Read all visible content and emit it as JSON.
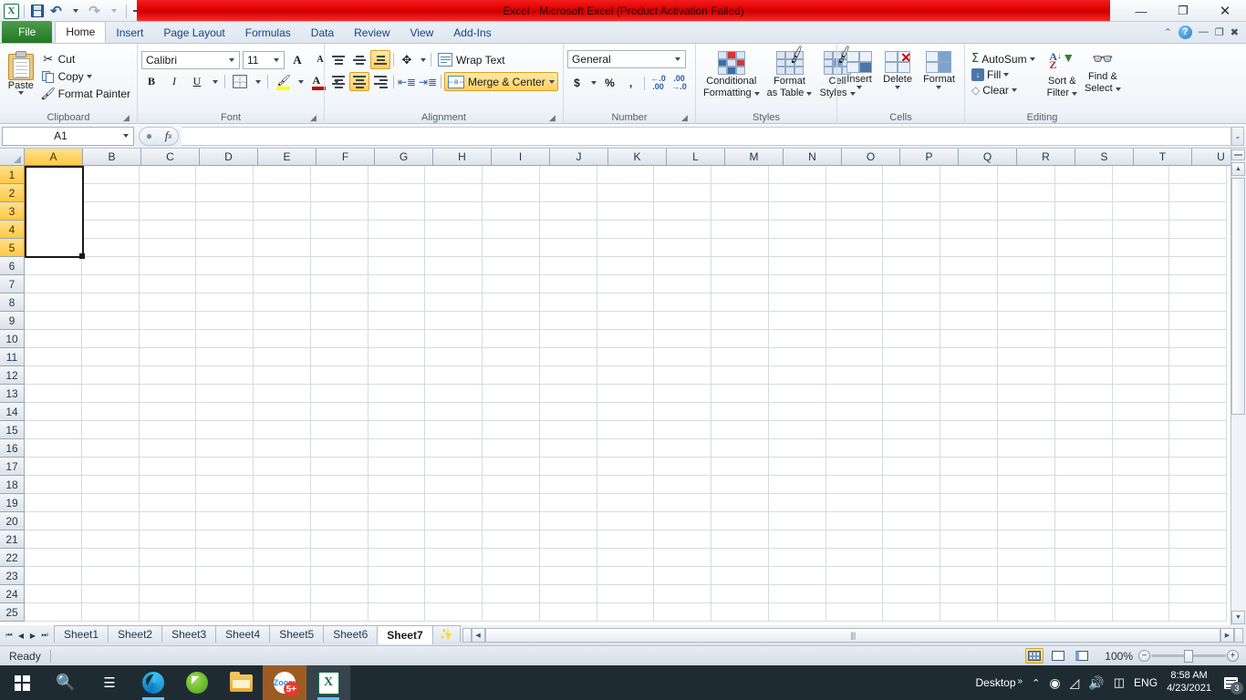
{
  "titlebar": {
    "title": "Excel  -  Microsoft Excel (Product Activation Failed)",
    "app_icon": "excel-logo-icon",
    "quick_access": [
      {
        "name": "save",
        "icon": "save-icon"
      },
      {
        "name": "undo",
        "icon": "undo-arrow-icon"
      },
      {
        "name": "redo",
        "icon": "redo-arrow-icon"
      },
      {
        "name": "customize",
        "icon": "customize-qat-icon"
      }
    ],
    "window_buttons": {
      "minimize": "—",
      "restore": "❐",
      "close": "✕"
    }
  },
  "ribbon_tabs": {
    "items": [
      {
        "label": "File"
      },
      {
        "label": "Home"
      },
      {
        "label": "Insert"
      },
      {
        "label": "Page Layout"
      },
      {
        "label": "Formulas"
      },
      {
        "label": "Data"
      },
      {
        "label": "Review"
      },
      {
        "label": "View"
      },
      {
        "label": "Add-Ins"
      }
    ],
    "active": "Home",
    "right_controls": {
      "collapse_ribbon": "⌃",
      "help": "?",
      "minimize": "—",
      "restore": "❐",
      "close": "✖"
    }
  },
  "ribbon": {
    "clipboard": {
      "label": "Clipboard",
      "paste": "Paste",
      "cut": "Cut",
      "copy": "Copy",
      "format_painter": "Format Painter"
    },
    "font": {
      "label": "Font",
      "font_name": "Calibri",
      "font_size": "11",
      "grow_font": "A",
      "shrink_font": "A",
      "bold": "B",
      "italic": "I",
      "underline": "U",
      "borders": "borders-icon",
      "fill_color": "A",
      "font_color": "A"
    },
    "alignment": {
      "label": "Alignment",
      "wrap_text": "Wrap Text",
      "merge_center": "Merge & Center",
      "orientation": "orientation-icon",
      "decrease_indent": "decrease-indent-icon",
      "increase_indent": "increase-indent-icon"
    },
    "number": {
      "label": "Number",
      "format": "General",
      "accounting": "$",
      "percent": "%",
      "comma": ",",
      "increase_decimal": ".00",
      "decrease_decimal": ".00"
    },
    "styles": {
      "label": "Styles",
      "conditional_formatting": "Conditional\nFormatting",
      "conditional_line1": "Conditional",
      "conditional_line2": "Formatting",
      "format_as_table_line1": "Format",
      "format_as_table_line2": "as Table",
      "cell_styles_line1": "Cell",
      "cell_styles_line2": "Styles"
    },
    "cells": {
      "label": "Cells",
      "insert": "Insert",
      "delete": "Delete",
      "format": "Format"
    },
    "editing": {
      "label": "Editing",
      "autosum": "AutoSum",
      "fill": "Fill",
      "clear": "Clear",
      "sort_filter_line1": "Sort &",
      "sort_filter_line2": "Filter",
      "find_select_line1": "Find &",
      "find_select_line2": "Select"
    }
  },
  "formula_bar": {
    "name_box": "A1",
    "formula_value": "",
    "fx_label": "fx",
    "cancel": "●",
    "expand": "⌄"
  },
  "grid": {
    "columns": [
      "A",
      "B",
      "C",
      "D",
      "E",
      "F",
      "G",
      "H",
      "I",
      "J",
      "K",
      "L",
      "M",
      "N",
      "O",
      "P",
      "Q",
      "R",
      "S",
      "T",
      "U"
    ],
    "rows": [
      1,
      2,
      3,
      4,
      5,
      6,
      7,
      8,
      9,
      10,
      11,
      12,
      13,
      14,
      15,
      16,
      17,
      18,
      19,
      20,
      21,
      22,
      23,
      24,
      25
    ],
    "selected_columns": [
      "A"
    ],
    "selected_rows": [
      1,
      2,
      3,
      4,
      5
    ],
    "selection_range": "A1:A5",
    "cell_values": {}
  },
  "sheet_tabs": {
    "items": [
      "Sheet1",
      "Sheet2",
      "Sheet3",
      "Sheet4",
      "Sheet5",
      "Sheet6",
      "Sheet7"
    ],
    "active": "Sheet7",
    "insert_sheet_icon": "insert-worksheet-icon",
    "nav": {
      "first": "◀│",
      "prev": "◀",
      "next": "▶",
      "last": "│▶"
    }
  },
  "status_bar": {
    "status": "Ready",
    "views": [
      {
        "name": "normal-view",
        "active": true
      },
      {
        "name": "page-layout-view",
        "active": false
      },
      {
        "name": "page-break-preview",
        "active": false
      }
    ],
    "zoom_level": "100%",
    "zoom_out": "−",
    "zoom_in": "+"
  },
  "taskbar": {
    "items": [
      {
        "name": "start-button",
        "icon": "windows-logo-icon"
      },
      {
        "name": "search-button",
        "icon": "search-icon"
      },
      {
        "name": "task-view-button",
        "icon": "task-view-icon"
      },
      {
        "name": "edge-button",
        "icon": "edge-icon"
      },
      {
        "name": "green-app-button",
        "icon": "green-app-icon"
      },
      {
        "name": "file-explorer-button",
        "icon": "folder-icon"
      },
      {
        "name": "zoom-button",
        "icon": "zoom-app-icon",
        "badge": "5+"
      },
      {
        "name": "excel-button",
        "icon": "excel-icon"
      }
    ],
    "tray": {
      "desktop_label": "Desktop",
      "overflow": "»",
      "show_hidden": "⌃",
      "camera": "camera-icon",
      "network": "wifi-icon",
      "volume": "volume-icon",
      "battery": "battery-icon",
      "language": "ENG",
      "time": "8:58 AM",
      "date": "4/23/2021",
      "notification_count": "3"
    }
  },
  "colors": {
    "title_red": "#e20000",
    "file_tab_green": "#2f8a2f",
    "selection_orange": "#ffc846",
    "accent_blue": "#15428b"
  }
}
